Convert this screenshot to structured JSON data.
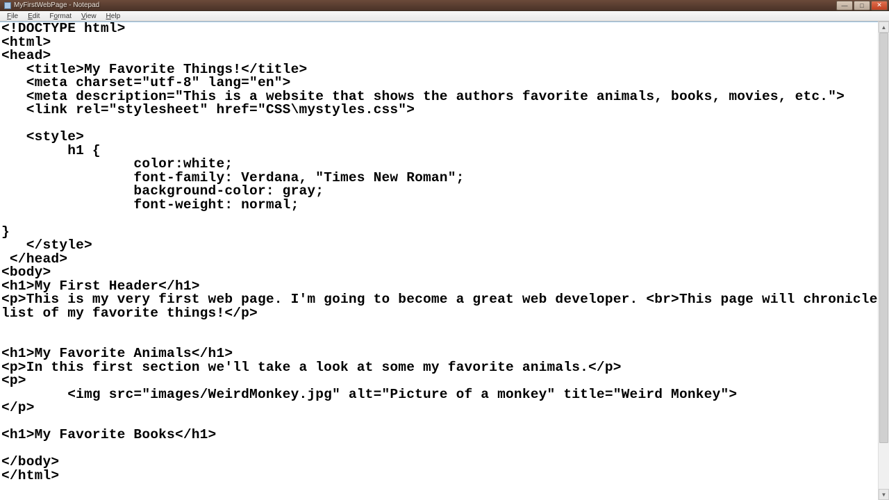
{
  "window": {
    "title": "MyFirstWebPage - Notepad"
  },
  "menu": {
    "file": "File",
    "edit": "Edit",
    "format": "Format",
    "view": "View",
    "help": "Help"
  },
  "editor": {
    "content": "<!DOCTYPE html>\n<html>\n<head>\n   <title>My Favorite Things!</title>\n   <meta charset=\"utf-8\" lang=\"en\">\n   <meta description=\"This is a website that shows the authors favorite animals, books, movies, etc.\">\n   <link rel=\"stylesheet\" href=\"CSS\\mystyles.css\">\n\n   <style>\n        h1 {\n                color:white;\n                font-family: Verdana, \"Times New Roman\";\n                background-color: gray;\n                font-weight: normal;\n\n}\n   </style>\n </head>\n<body>\n<h1>My First Header</h1>\n<p>This is my very first web page. I'm going to become a great web developer. <br>This page will chronicle a\nlist of my favorite things!</p>\n\n\n<h1>My Favorite Animals</h1>\n<p>In this first section we'll take a look at some my favorite animals.</p>\n<p>\n        <img src=\"images/WeirdMonkey.jpg\" alt=\"Picture of a monkey\" title=\"Weird Monkey\">\n</p>\n\n<h1>My Favorite Books</h1>\n\n</body>\n</html>"
  },
  "controls": {
    "minimize": "—",
    "maximize": "□",
    "close": "✕",
    "scroll_up": "▲",
    "scroll_down": "▼"
  }
}
